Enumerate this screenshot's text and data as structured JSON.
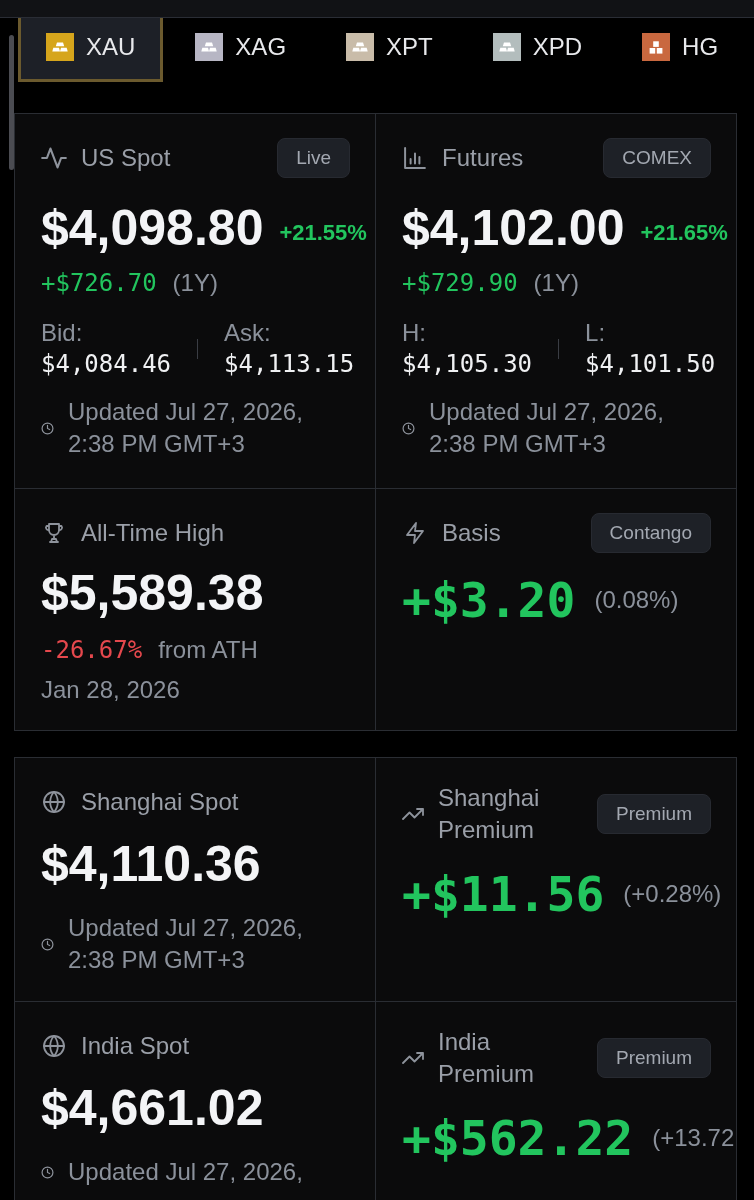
{
  "tabs": [
    {
      "label": "XAU",
      "selected": true,
      "kind": "ingots",
      "color": "#d6a51c"
    },
    {
      "label": "XAG",
      "selected": false,
      "kind": "ingots",
      "color": "#b7b6c4"
    },
    {
      "label": "XPT",
      "selected": false,
      "kind": "ingots",
      "color": "#c9bca9"
    },
    {
      "label": "XPD",
      "selected": false,
      "kind": "ingots",
      "color": "#b3bdbd"
    },
    {
      "label": "HG",
      "selected": false,
      "kind": "blocks",
      "color": "#c9683f"
    }
  ],
  "panels": [
    {
      "cards": [
        {
          "kind": "spot",
          "title": "US Spot",
          "badge": "Live",
          "price": "$4,098.80",
          "change_pct": "+21.55%",
          "change": "+$726.70",
          "period": "(1Y)",
          "negative": false,
          "stats": [
            {
              "label": "Bid:",
              "value": "$4,084.46"
            },
            {
              "label": "Ask:",
              "value": "$4,113.15"
            }
          ],
          "updated": "Updated Jul 27, 2026, 2:38 PM GMT+3"
        },
        {
          "kind": "futures",
          "title": "Futures",
          "badge": "COMEX",
          "price": "$4,102.00",
          "change_pct": "+21.65%",
          "change": "+$729.90",
          "period": "(1Y)",
          "negative": false,
          "stats": [
            {
              "label": "H:",
              "value": "$4,105.30"
            },
            {
              "label": "L:",
              "value": "$4,101.50"
            }
          ],
          "updated": "Updated Jul 27, 2026, 2:38 PM GMT+3"
        },
        {
          "kind": "ath",
          "title": "All-Time High",
          "price": "$5,589.38",
          "change": "-26.67%",
          "note": "from ATH",
          "negative": true,
          "date": "Jan 28, 2026"
        },
        {
          "kind": "basis",
          "title": "Basis",
          "badge": "Contango",
          "value": "+$3.20",
          "pct": "(0.08%)",
          "negative": false
        }
      ]
    },
    {
      "cards": [
        {
          "kind": "regional",
          "title": "Shanghai Spot",
          "price": "$4,110.36",
          "updated": "Updated Jul 27, 2026, 2:38 PM GMT+3"
        },
        {
          "kind": "premium",
          "title": "Shanghai Premium",
          "badge": "Premium",
          "value": "+$11.56",
          "pct": "(+0.28%)",
          "negative": false
        },
        {
          "kind": "regional",
          "title": "India Spot",
          "price": "$4,661.02",
          "updated": "Updated Jul 27, 2026,"
        },
        {
          "kind": "premium",
          "title": "India Premium",
          "badge": "Premium",
          "value": "+$562.22",
          "pct": "(+13.72",
          "negative": false
        }
      ]
    }
  ]
}
